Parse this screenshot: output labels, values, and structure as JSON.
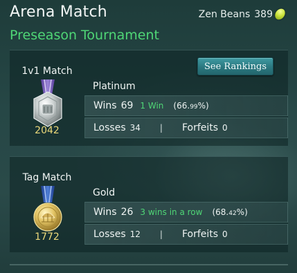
{
  "header": {
    "title": "Arena Match",
    "subtitle": "Preseason Tournament",
    "currency_label": "Zen Beans",
    "currency_amount": "389",
    "currency_icon": "zen-bean-icon"
  },
  "colors": {
    "accent_green": "#4fd676",
    "rating_gold": "#ecd97a",
    "button_teal": "#2b7880"
  },
  "see_rankings_label": "See Rankings",
  "modes": [
    {
      "label": "1v1 Match",
      "medal_icon": "platinum-medal-icon",
      "rating": "2042",
      "tier": "Platinum",
      "wins_label": "Wins",
      "wins": "69",
      "streak": "1 Win",
      "pct_open": "(66.",
      "pct_decimal": "99",
      "pct_close": "%)",
      "losses_label": "Losses",
      "losses": "34",
      "separator": "|",
      "forfeits_label": "Forfeits",
      "forfeits": "0"
    },
    {
      "label": "Tag Match",
      "medal_icon": "gold-medal-icon",
      "rating": "1772",
      "tier": "Gold",
      "wins_label": "Wins",
      "wins": "26",
      "streak": "3 wins in a row",
      "pct_open": "(68.",
      "pct_decimal": "42",
      "pct_close": "%)",
      "losses_label": "Losses",
      "losses": "12",
      "separator": "|",
      "forfeits_label": "Forfeits",
      "forfeits": "0"
    }
  ]
}
